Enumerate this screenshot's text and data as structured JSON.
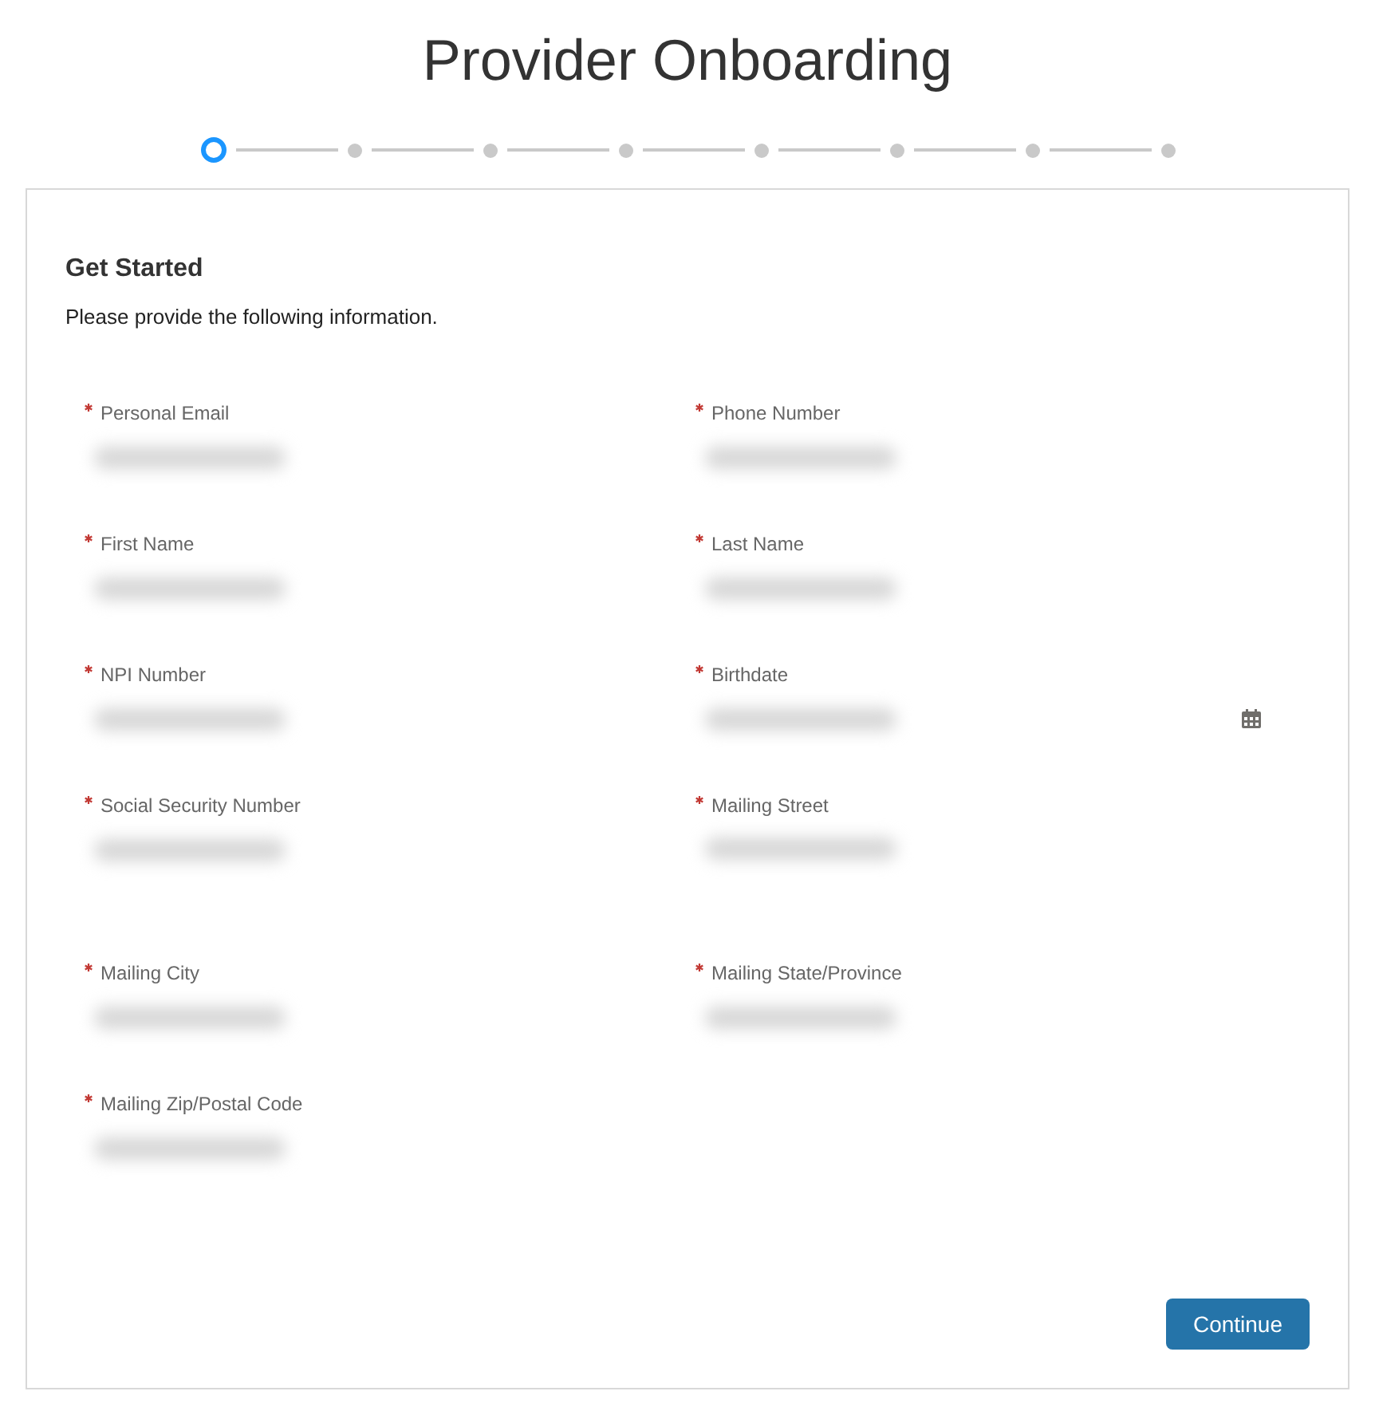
{
  "title": "Provider Onboarding",
  "steps": [
    {
      "selected": true
    },
    {
      "selected": false
    },
    {
      "selected": false
    },
    {
      "selected": false
    },
    {
      "selected": false
    },
    {
      "selected": false
    },
    {
      "selected": false
    },
    {
      "selected": false
    }
  ],
  "card": {
    "heading": "Get Started",
    "instructions": "Please provide the following information.",
    "fields": [
      {
        "label": "Personal Email",
        "required": true,
        "kind": "text",
        "redacted": true
      },
      {
        "label": "Phone Number",
        "required": true,
        "kind": "text",
        "redacted": true
      },
      {
        "label": "First Name",
        "required": true,
        "kind": "text",
        "redacted": true
      },
      {
        "label": "Last Name",
        "required": true,
        "kind": "text",
        "redacted": true
      },
      {
        "label": "NPI Number",
        "required": true,
        "kind": "text",
        "redacted": true
      },
      {
        "label": "Birthdate",
        "required": true,
        "kind": "date",
        "redacted": true
      },
      {
        "label": "Social Security Number",
        "required": true,
        "kind": "text",
        "redacted": true
      },
      {
        "label": "Mailing Street",
        "required": true,
        "kind": "textarea",
        "redacted": true
      },
      {
        "label": "Mailing City",
        "required": true,
        "kind": "text",
        "redacted": true
      },
      {
        "label": "Mailing State/Province",
        "required": true,
        "kind": "text",
        "redacted": true
      },
      {
        "label": "Mailing Zip/Postal Code",
        "required": true,
        "kind": "text",
        "redacted": true
      }
    ],
    "button": "Continue"
  }
}
